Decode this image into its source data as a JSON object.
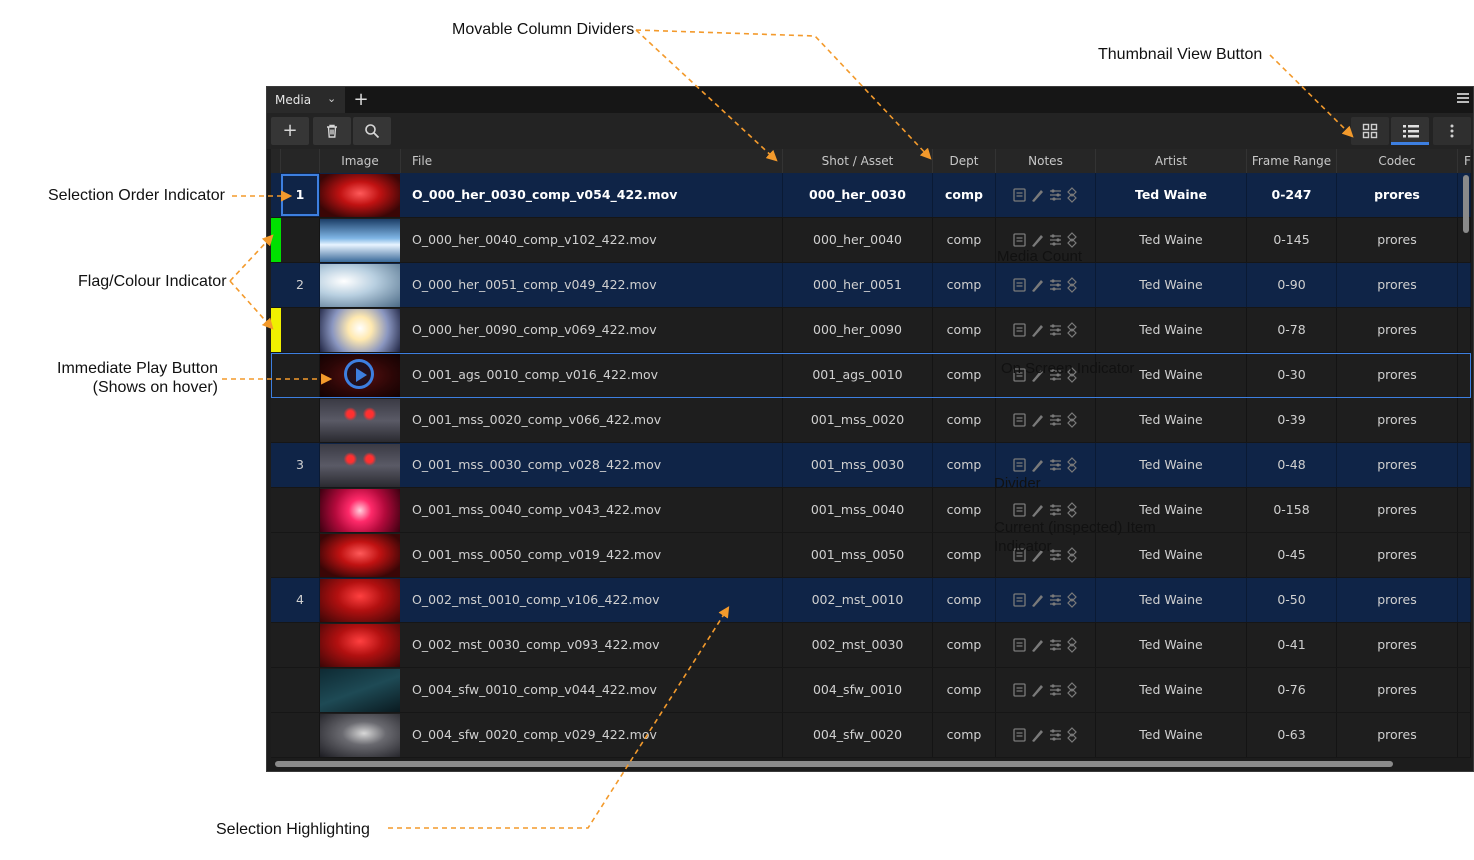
{
  "annotations": {
    "movable_column_dividers": "Movable Column Dividers",
    "thumbnail_view_button": "Thumbnail View Button",
    "selection_order_indicator": "Selection Order Indicator",
    "flag_colour_indicator": "Flag/Colour Indicator",
    "immediate_play_line1": "Immediate Play Button",
    "immediate_play_line2": "(Shows on hover)",
    "selection_highlighting": "Selection Highlighting",
    "media_count": "Media Count",
    "on_screen_indicator": "On Screen Indicator",
    "divider": "Divider",
    "current_item_line1": "Current (inspected) Item",
    "current_item_line2": "Indicator"
  },
  "tab": {
    "label": "Media",
    "add": "+"
  },
  "toolbar": {
    "add": "+",
    "delete_icon": "trash-icon",
    "search_icon": "search-icon"
  },
  "colors": {
    "accent": "#3d7fe0",
    "selected_row": "#0f2447",
    "flag_green": "#00e000",
    "flag_yellow": "#f0f000",
    "arrow": "#f39a2c"
  },
  "columns": {
    "image": "Image",
    "file": "File",
    "shot": "Shot / Asset",
    "dept": "Dept",
    "notes": "Notes",
    "artist": "Artist",
    "frame_range": "Frame Range",
    "codec": "Codec",
    "extra": "F"
  },
  "rows": [
    {
      "order": "1",
      "file": "O_000_her_0030_comp_v054_422.mov",
      "shot": "000_her_0030",
      "dept": "comp",
      "artist": "Ted Waine",
      "frames": "0-247",
      "codec": "prores",
      "selected": true,
      "current": true,
      "flag": "",
      "thumb": "red-figure"
    },
    {
      "order": "",
      "file": "O_000_her_0040_comp_v102_422.mov",
      "shot": "000_her_0040",
      "dept": "comp",
      "artist": "Ted Waine",
      "frames": "0-145",
      "codec": "prores",
      "selected": false,
      "flag": "green",
      "thumb": "blue-splash"
    },
    {
      "order": "2",
      "file": "O_000_her_0051_comp_v049_422.mov",
      "shot": "000_her_0051",
      "dept": "comp",
      "artist": "Ted Waine",
      "frames": "0-90",
      "codec": "prores",
      "selected": true,
      "flag": "",
      "thumb": "pale-blue"
    },
    {
      "order": "",
      "file": "O_000_her_0090_comp_v069_422.mov",
      "shot": "000_her_0090",
      "dept": "comp",
      "artist": "Ted Waine",
      "frames": "0-78",
      "codec": "prores",
      "selected": false,
      "flag": "yellow",
      "thumb": "bright-burst"
    },
    {
      "order": "",
      "file": "O_001_ags_0010_comp_v016_422.mov",
      "shot": "001_ags_0010",
      "dept": "comp",
      "artist": "Ted Waine",
      "frames": "0-30",
      "codec": "prores",
      "selected": false,
      "flag": "",
      "hover": true,
      "thumb": "dark-red"
    },
    {
      "order": "",
      "file": "O_001_mss_0020_comp_v066_422.mov",
      "shot": "001_mss_0020",
      "dept": "comp",
      "artist": "Ted Waine",
      "frames": "0-39",
      "codec": "prores",
      "selected": false,
      "flag": "",
      "thumb": "red-eyes"
    },
    {
      "order": "3",
      "file": "O_001_mss_0030_comp_v028_422.mov",
      "shot": "001_mss_0030",
      "dept": "comp",
      "artist": "Ted Waine",
      "frames": "0-48",
      "codec": "prores",
      "selected": true,
      "flag": "",
      "thumb": "red-eyes"
    },
    {
      "order": "",
      "file": "O_001_mss_0040_comp_v043_422.mov",
      "shot": "001_mss_0040",
      "dept": "comp",
      "artist": "Ted Waine",
      "frames": "0-158",
      "codec": "prores",
      "selected": false,
      "flag": "",
      "thumb": "pink-spiral"
    },
    {
      "order": "",
      "file": "O_001_mss_0050_comp_v019_422.mov",
      "shot": "001_mss_0050",
      "dept": "comp",
      "artist": "Ted Waine",
      "frames": "0-45",
      "codec": "prores",
      "selected": false,
      "flag": "",
      "thumb": "red-figure"
    },
    {
      "order": "4",
      "file": "O_002_mst_0010_comp_v106_422.mov",
      "shot": "002_mst_0010",
      "dept": "comp",
      "artist": "Ted Waine",
      "frames": "0-50",
      "codec": "prores",
      "selected": true,
      "flag": "",
      "thumb": "red-creature"
    },
    {
      "order": "",
      "file": "O_002_mst_0030_comp_v093_422.mov",
      "shot": "002_mst_0030",
      "dept": "comp",
      "artist": "Ted Waine",
      "frames": "0-41",
      "codec": "prores",
      "selected": false,
      "flag": "",
      "thumb": "red-creature"
    },
    {
      "order": "",
      "file": "O_004_sfw_0010_comp_v044_422.mov",
      "shot": "004_sfw_0010",
      "dept": "comp",
      "artist": "Ted Waine",
      "frames": "0-76",
      "codec": "prores",
      "selected": false,
      "flag": "",
      "thumb": "dark-teal"
    },
    {
      "order": "",
      "file": "O_004_sfw_0020_comp_v029_422.mov",
      "shot": "004_sfw_0020",
      "dept": "comp",
      "artist": "Ted Waine",
      "frames": "0-63",
      "codec": "prores",
      "selected": false,
      "flag": "",
      "thumb": "dark-grey"
    }
  ]
}
